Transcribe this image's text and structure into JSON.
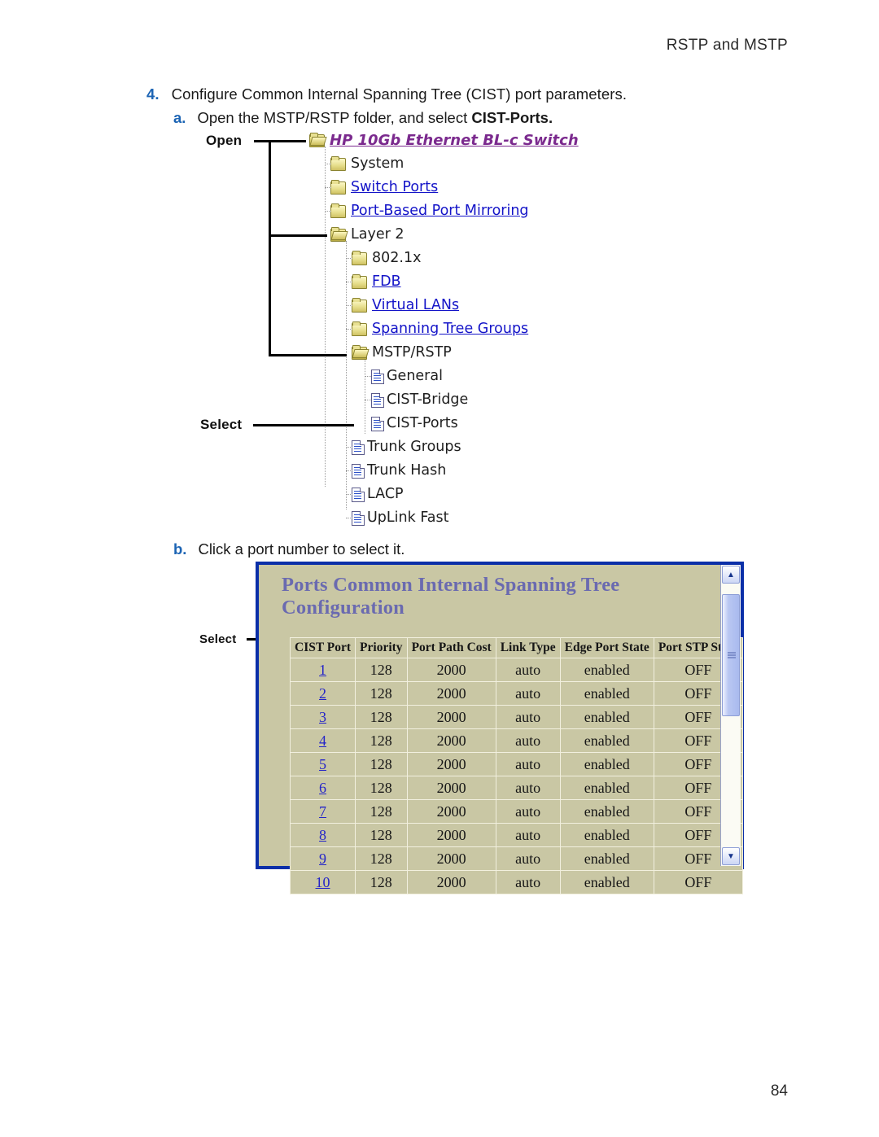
{
  "document": {
    "running_head": "RSTP and MSTP",
    "page_number": "84"
  },
  "steps": {
    "step4": {
      "marker": "4.",
      "text": "Configure Common Internal Spanning Tree (CIST) port parameters."
    },
    "stepA": {
      "marker": "a.",
      "text_before": "Open the MSTP/RSTP folder, and select ",
      "bold": "CIST-Ports."
    },
    "stepB": {
      "marker": "b.",
      "text": "Click a port number to select it."
    }
  },
  "callouts": {
    "open": "Open",
    "select_tree": "Select",
    "select_table": "Select"
  },
  "tree": {
    "nodes": [
      {
        "label": "HP 10Gb Ethernet BL-c Switch",
        "icon": "folder-open-icon",
        "style": "root"
      },
      {
        "label": "System",
        "icon": "folder-icon",
        "style": "plain"
      },
      {
        "label": "Switch Ports",
        "icon": "folder-icon",
        "style": "link"
      },
      {
        "label": "Port-Based Port Mirroring",
        "icon": "folder-icon",
        "style": "link"
      },
      {
        "label": "Layer 2",
        "icon": "folder-open-icon",
        "style": "plain"
      },
      {
        "label": "802.1x",
        "icon": "folder-icon",
        "style": "plain"
      },
      {
        "label": "FDB",
        "icon": "folder-icon",
        "style": "link"
      },
      {
        "label": "Virtual LANs",
        "icon": "folder-icon",
        "style": "link"
      },
      {
        "label": "Spanning Tree Groups",
        "icon": "folder-icon",
        "style": "link"
      },
      {
        "label": "MSTP/RSTP",
        "icon": "folder-open-icon",
        "style": "plain"
      },
      {
        "label": "General",
        "icon": "file-icon",
        "style": "plain"
      },
      {
        "label": "CIST-Bridge",
        "icon": "file-icon",
        "style": "plain"
      },
      {
        "label": "CIST-Ports",
        "icon": "file-icon",
        "style": "plain"
      },
      {
        "label": "Trunk Groups",
        "icon": "file-icon",
        "style": "plain"
      },
      {
        "label": "Trunk Hash",
        "icon": "file-icon",
        "style": "plain"
      },
      {
        "label": "LACP",
        "icon": "file-icon",
        "style": "plain"
      },
      {
        "label": "UpLink Fast",
        "icon": "file-icon",
        "style": "plain"
      }
    ]
  },
  "panel": {
    "title": "Ports Common Internal Spanning Tree Configuration",
    "columns": [
      "CIST Port",
      "Priority",
      "Port Path Cost",
      "Link Type",
      "Edge Port State",
      "Port STP State"
    ],
    "rows": [
      {
        "port": "1",
        "priority": "128",
        "path_cost": "2000",
        "link_type": "auto",
        "edge_port_state": "enabled",
        "port_stp_state": "OFF"
      },
      {
        "port": "2",
        "priority": "128",
        "path_cost": "2000",
        "link_type": "auto",
        "edge_port_state": "enabled",
        "port_stp_state": "OFF"
      },
      {
        "port": "3",
        "priority": "128",
        "path_cost": "2000",
        "link_type": "auto",
        "edge_port_state": "enabled",
        "port_stp_state": "OFF"
      },
      {
        "port": "4",
        "priority": "128",
        "path_cost": "2000",
        "link_type": "auto",
        "edge_port_state": "enabled",
        "port_stp_state": "OFF"
      },
      {
        "port": "5",
        "priority": "128",
        "path_cost": "2000",
        "link_type": "auto",
        "edge_port_state": "enabled",
        "port_stp_state": "OFF"
      },
      {
        "port": "6",
        "priority": "128",
        "path_cost": "2000",
        "link_type": "auto",
        "edge_port_state": "enabled",
        "port_stp_state": "OFF"
      },
      {
        "port": "7",
        "priority": "128",
        "path_cost": "2000",
        "link_type": "auto",
        "edge_port_state": "enabled",
        "port_stp_state": "OFF"
      },
      {
        "port": "8",
        "priority": "128",
        "path_cost": "2000",
        "link_type": "auto",
        "edge_port_state": "enabled",
        "port_stp_state": "OFF"
      },
      {
        "port": "9",
        "priority": "128",
        "path_cost": "2000",
        "link_type": "auto",
        "edge_port_state": "enabled",
        "port_stp_state": "OFF"
      },
      {
        "port": "10",
        "priority": "128",
        "path_cost": "2000",
        "link_type": "auto",
        "edge_port_state": "enabled",
        "port_stp_state": "OFF"
      }
    ],
    "scrollbar": {
      "up_glyph": "▲",
      "down_glyph": "▼"
    }
  },
  "colors": {
    "accent_blue": "#1c64b4",
    "link_blue": "#1414c8",
    "root_purple": "#7b2a8e",
    "panel_bg": "#c9c7a4",
    "panel_border": "#0b2fa8",
    "panel_title": "#6a6ab0"
  }
}
